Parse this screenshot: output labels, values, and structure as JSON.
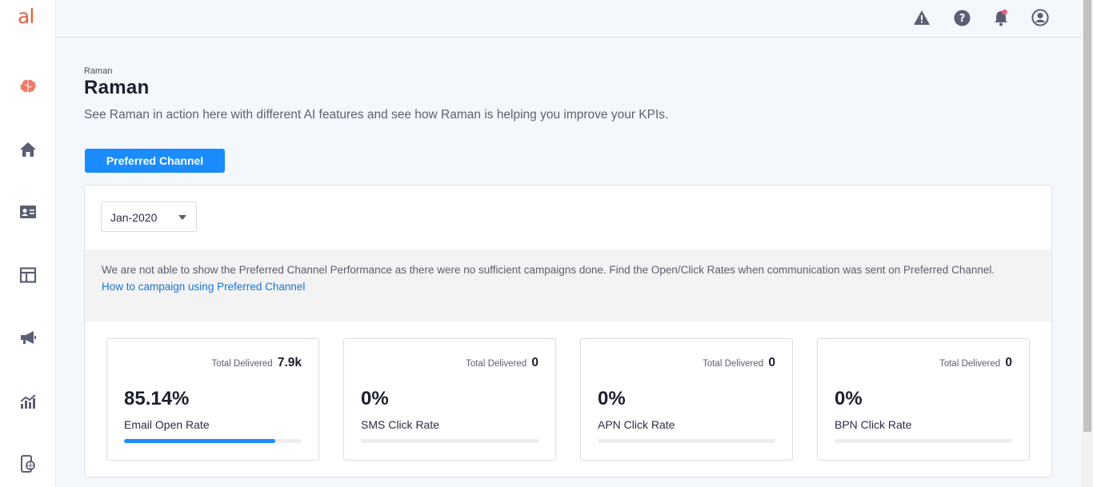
{
  "sidebar": {
    "logo": "al",
    "items": [
      {
        "icon": "brain-icon",
        "color": "#f07a6a"
      },
      {
        "icon": "home-icon"
      },
      {
        "icon": "contact-card-icon"
      },
      {
        "icon": "layout-icon"
      },
      {
        "icon": "megaphone-icon"
      },
      {
        "icon": "analytics-chart-icon"
      },
      {
        "icon": "mobile-web-icon"
      }
    ]
  },
  "topbar": {
    "icons": [
      "warning-icon",
      "help-icon",
      "notification-bell-icon",
      "user-profile-icon"
    ]
  },
  "header": {
    "breadcrumb": "Raman",
    "title": "Raman",
    "subtitle": "See Raman in action here with different AI features and see how Raman is helping you improve your KPIs."
  },
  "tab_button": "Preferred Channel",
  "panel": {
    "date_select": "Jan-2020",
    "notice": "We are not able to show the Preferred Channel Performance as there were no sufficient campaigns done. Find the Open/Click Rates when communication was sent on Preferred Channel.",
    "notice_link": "How to campaign using Preferred Channel",
    "cards": [
      {
        "delivered_label": "Total Delivered",
        "delivered_value": "7.9k",
        "rate": "85.14%",
        "label": "Email Open Rate",
        "progress": 0.8514
      },
      {
        "delivered_label": "Total Delivered",
        "delivered_value": "0",
        "rate": "0%",
        "label": "SMS Click Rate",
        "progress": 0
      },
      {
        "delivered_label": "Total Delivered",
        "delivered_value": "0",
        "rate": "0%",
        "label": "APN Click Rate",
        "progress": 0
      },
      {
        "delivered_label": "Total Delivered",
        "delivered_value": "0",
        "rate": "0%",
        "label": "BPN Click Rate",
        "progress": 0
      }
    ]
  },
  "colors": {
    "accent": "#1a8cff",
    "logo": "#e8613c",
    "icon": "#5a5f73",
    "notification_dot": "#f0607a"
  }
}
